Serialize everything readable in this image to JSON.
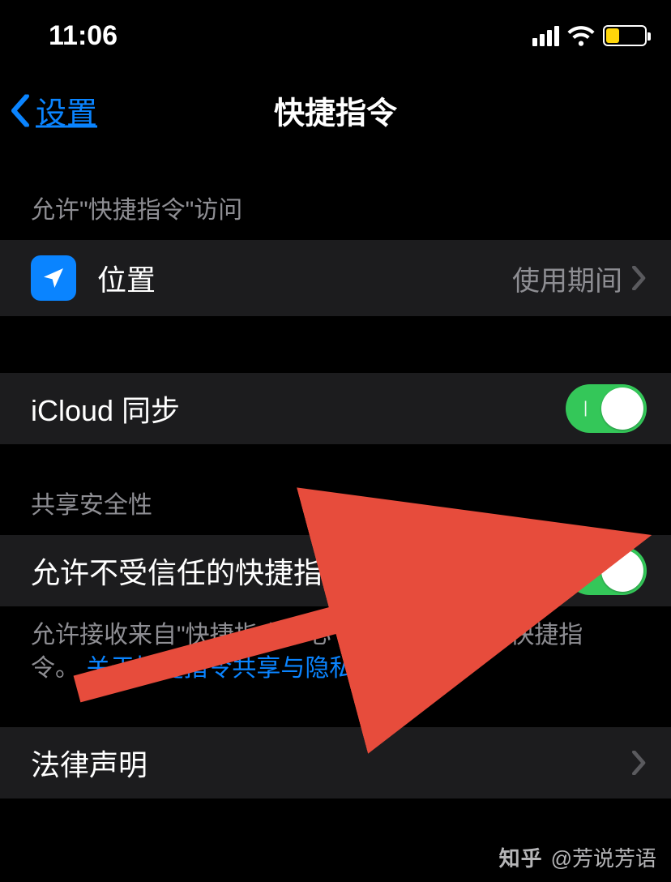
{
  "status": {
    "time": "11:06"
  },
  "nav": {
    "back_label": "设置",
    "title": "快捷指令"
  },
  "sections": {
    "access_header": "允许\"快捷指令\"访问",
    "location": {
      "label": "位置",
      "value": "使用期间"
    },
    "icloud": {
      "label": "iCloud 同步"
    },
    "security_header": "共享安全性",
    "untrusted": {
      "label": "允许不受信任的快捷指令"
    },
    "untrusted_footer_pre": "允许接收来自\"快捷指令中心\"之外的不受信任快捷指令。 ",
    "untrusted_footer_link": "关于快捷指令共享与隐私…",
    "legal": {
      "label": "法律声明"
    }
  },
  "watermark": {
    "logo": "知乎",
    "handle": "@芳说芳语"
  }
}
